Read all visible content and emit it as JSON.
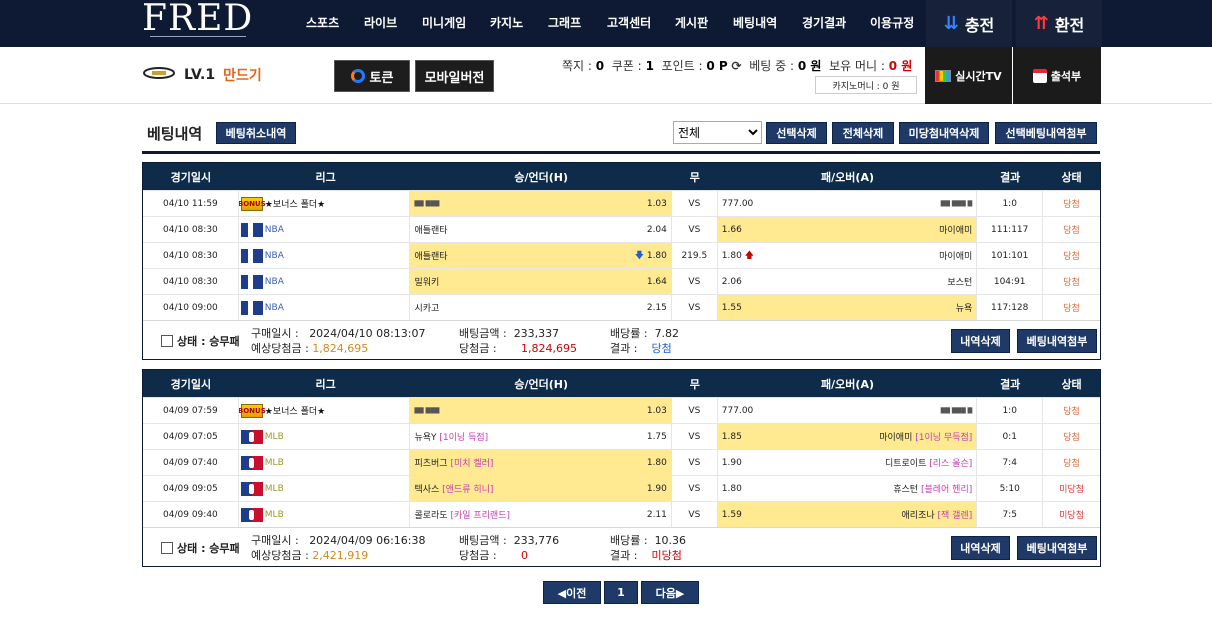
{
  "brand": {
    "logo": "FRED"
  },
  "nav": {
    "items": [
      "스포츠",
      "라이브",
      "미니게임",
      "카지노",
      "그래프",
      "고객센터",
      "게시판",
      "베팅내역",
      "경기결과",
      "이용규정"
    ],
    "deposit": "충전",
    "withdraw": "환전"
  },
  "user": {
    "level": "LV.1",
    "name": "만드기"
  },
  "buttons": {
    "token": "토큰",
    "mobile": "모바일버전",
    "live_tv": "실시간TV",
    "attendance": "출석부"
  },
  "stats": {
    "msg_label": "쪽지 :",
    "msg": "0",
    "coupon_label": "쿠폰 :",
    "coupon": "1",
    "point_label": "포인트 :",
    "point": "0 P",
    "betting_label": "베팅 중 :",
    "betting": "0 원",
    "hold_label": "보유 머니 :",
    "hold": "0 원",
    "casino": "카지노머니 : 0 원"
  },
  "history": {
    "title": "베팅내역",
    "cancel_history": "베팅취소내역",
    "filter": "전체",
    "filter_options": [
      "전체"
    ],
    "delete_selected": "선택삭제",
    "delete_all": "전체삭제",
    "delete_unwon": "미당첨내역삭제",
    "attach_selected": "선택베팅내역첨부"
  },
  "columns": [
    "경기일시",
    "리그",
    "승/언더(H)",
    "무",
    "패/오버(A)",
    "결과",
    "상태"
  ],
  "slip1": {
    "rows": [
      {
        "date": "04/10 11:59",
        "league": "★보너스 폴더★",
        "home": "",
        "home_odds": "1.03",
        "mid": "VS",
        "away": "777.00",
        "away_odds": "",
        "score": "1:0",
        "status": "당첨"
      },
      {
        "date": "04/10 08:30",
        "league": "NBA",
        "home": "애틀랜타",
        "home_odds": "2.04",
        "mid": "VS",
        "away": "1.66",
        "away_name": "마이애미",
        "score": "111:117",
        "status": "당첨"
      },
      {
        "date": "04/10 08:30",
        "league": "NBA",
        "home": "애틀랜타",
        "home_odds": "1.80",
        "mid": "219.5",
        "away": "1.80",
        "away_name": "마이애미",
        "score": "101:101",
        "status": "당첨"
      },
      {
        "date": "04/10 08:30",
        "league": "NBA",
        "home": "밀워키",
        "home_odds": "1.64",
        "mid": "VS",
        "away": "2.06",
        "away_name": "보스턴",
        "score": "104:91",
        "status": "당첨"
      },
      {
        "date": "04/10 09:00",
        "league": "NBA",
        "home": "시카고",
        "home_odds": "2.15",
        "mid": "VS",
        "away": "1.55",
        "away_name": "뉴욕",
        "score": "117:128",
        "status": "당첨"
      }
    ],
    "footer": {
      "status": "상태 : 승무패",
      "buy_label": "구매일시 :",
      "buy": "2024/04/10 08:13:07",
      "expect_label": "예상당첨금 :",
      "expect": "1,824,695",
      "bet_label": "배팅금액 :",
      "bet": "233,337",
      "win_label": "당첨금 :",
      "win": "1,824,695",
      "rate_label": "배당률 :",
      "rate": "7.82",
      "result_label": "결과 :",
      "result": "당첨",
      "delete": "내역삭제",
      "attach": "베팅내역첨부"
    }
  },
  "slip2": {
    "rows": [
      {
        "date": "04/09 07:59",
        "league": "★보너스 폴더★",
        "home": "",
        "home_odds": "1.03",
        "mid": "VS",
        "away": "777.00",
        "away_odds": "",
        "score": "1:0",
        "status": "당첨"
      },
      {
        "date": "04/09 07:05",
        "league": "MLB",
        "home": "뉴욕Y",
        "home_sub": "[1이닝 득점]",
        "home_odds": "1.75",
        "mid": "VS",
        "away": "1.85",
        "away_name": "마이애미",
        "away_sub": "[1이닝 무득점]",
        "score": "0:1",
        "status": "당첨"
      },
      {
        "date": "04/09 07:40",
        "league": "MLB",
        "home": "피츠버그",
        "home_sub": "[미치 켈러]",
        "home_odds": "1.80",
        "mid": "VS",
        "away": "1.90",
        "away_name": "디트로이트",
        "away_sub": "[리스 올슨]",
        "score": "7:4",
        "status": "당첨"
      },
      {
        "date": "04/09 09:05",
        "league": "MLB",
        "home": "텍사스",
        "home_sub": "[앤드류 히니]",
        "home_odds": "1.90",
        "mid": "VS",
        "away": "1.80",
        "away_name": "휴스턴",
        "away_sub": "[블레어 헨리]",
        "score": "5:10",
        "status": "미당첨"
      },
      {
        "date": "04/09 09:40",
        "league": "MLB",
        "home": "콜로라도",
        "home_sub": "[카일 프리랜드]",
        "home_odds": "2.11",
        "mid": "VS",
        "away": "1.59",
        "away_name": "애리조나",
        "away_sub": "[잭 갤렌]",
        "score": "7:5",
        "status": "미당첨"
      }
    ],
    "footer": {
      "status": "상태 : 승무패",
      "buy_label": "구매일시 :",
      "buy": "2024/04/09 06:16:38",
      "expect_label": "예상당첨금 :",
      "expect": "2,421,919",
      "bet_label": "배팅금액 :",
      "bet": "233,776",
      "win_label": "당첨금 :",
      "win": "0",
      "rate_label": "배당률 :",
      "rate": "10.36",
      "result_label": "결과 :",
      "result": "미당첨",
      "delete": "내역삭제",
      "attach": "베팅내역첨부"
    }
  },
  "pager": {
    "prev": "◀이전",
    "page": "1",
    "next": "다음▶"
  }
}
